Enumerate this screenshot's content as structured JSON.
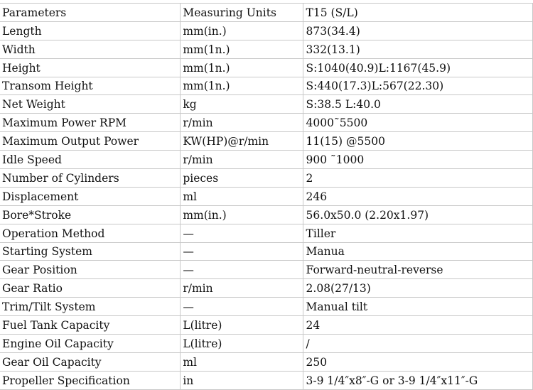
{
  "table": {
    "rows": [
      [
        "Parameters",
        "Measuring Units",
        "T15 (S/L)"
      ],
      [
        "Length",
        "mm(in.)",
        "873(34.4)"
      ],
      [
        "Width",
        "mm(1n.)",
        "332(13.1)"
      ],
      [
        "Height",
        "mm(1n.)",
        "S:1040(40.9)L:1167(45.9)"
      ],
      [
        "Transom Height",
        "mm(1n.)",
        "S:440(17.3)L:567(22.30)"
      ],
      [
        "Net Weight",
        "kg",
        "S:38.5 L:40.0"
      ],
      [
        "Maximum Power RPM",
        "r/min",
        "4000˜5500"
      ],
      [
        "Maximum Output Power",
        "KW(HP)@r/min",
        "11(15) @5500"
      ],
      [
        "Idle Speed",
        "r/min",
        "900 ˜1000"
      ],
      [
        "Number of Cylinders",
        "pieces",
        "2"
      ],
      [
        "Displacement",
        "ml",
        "246"
      ],
      [
        "Bore*Stroke",
        "mm(in.)",
        "56.0x50.0 (2.20x1.97)"
      ],
      [
        "Operation Method",
        "—",
        "Tiller"
      ],
      [
        "Starting System",
        "—",
        "Manua"
      ],
      [
        "Gear Position",
        "—",
        "Forward-neutral-reverse"
      ],
      [
        "Gear Ratio",
        "r/min",
        "2.08(27/13)"
      ],
      [
        "Trim/Tilt System",
        "—",
        "Manual tilt"
      ],
      [
        "Fuel Tank Capacity",
        "L(litre)",
        "24"
      ],
      [
        "Engine Oil Capacity",
        "L(litre)",
        "/"
      ],
      [
        "Gear Oil Capacity",
        "ml",
        "250"
      ],
      [
        "Propeller Specification",
        "in",
        "3-9 1/4″x8″-G or 3-9 1/4″x11″-G"
      ]
    ]
  }
}
